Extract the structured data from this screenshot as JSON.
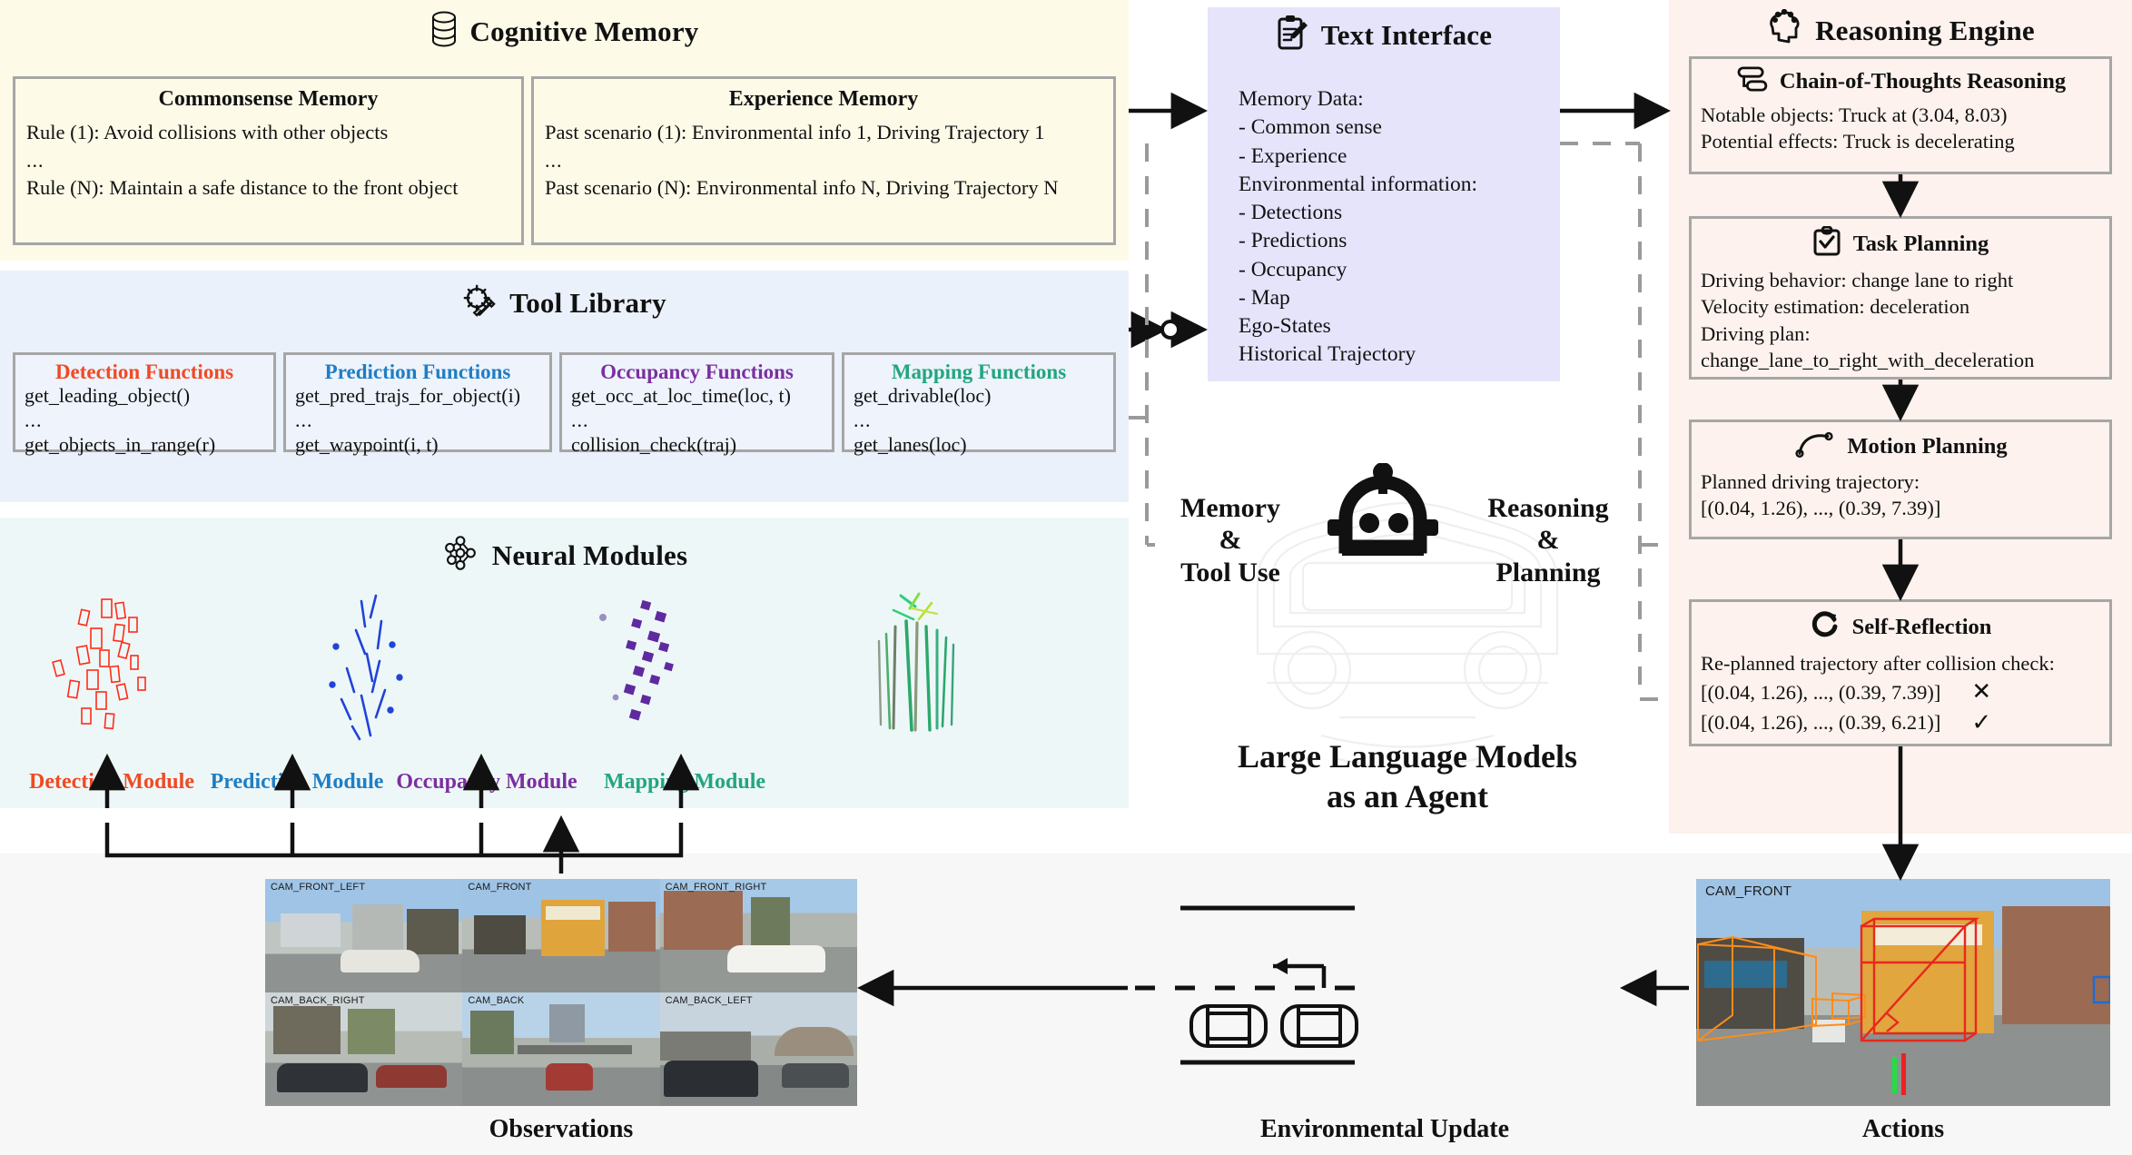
{
  "cognitive_memory": {
    "title": "Cognitive Memory",
    "icon": "database-icon",
    "commonsense": {
      "title": "Commonsense Memory",
      "lines": [
        "Rule (1): Avoid collisions with other objects",
        "...",
        "Rule (N): Maintain a safe distance to the front object"
      ]
    },
    "experience": {
      "title": "Experience Memory",
      "lines": [
        "Past scenario (1): Environmental info 1, Driving Trajectory 1",
        "...",
        "Past scenario (N): Environmental info N, Driving Trajectory N"
      ]
    }
  },
  "tool_library": {
    "title": "Tool Library",
    "icon": "gear-wrench-icon",
    "groups": [
      {
        "title": "Detection Functions",
        "color": "#f04a23",
        "lines": [
          "get_leading_object()",
          "...",
          "get_objects_in_range(r)"
        ]
      },
      {
        "title": "Prediction Functions",
        "color": "#1f7ec4",
        "lines": [
          "get_pred_trajs_for_object(i)",
          "...",
          "get_waypoint(i, t)"
        ]
      },
      {
        "title": "Occupancy Functions",
        "color": "#7b2fa0",
        "lines": [
          "get_occ_at_loc_time(loc, t)",
          "...",
          "collision_check(traj)"
        ]
      },
      {
        "title": "Mapping Functions",
        "color": "#22a67e",
        "lines": [
          "get_drivable(loc)",
          "...",
          "get_lanes(loc)"
        ]
      }
    ]
  },
  "neural_modules": {
    "title": "Neural Modules",
    "icon": "neural-network-icon",
    "modules": [
      {
        "label": "Detection Module",
        "color": "#f04a23"
      },
      {
        "label": "Prediction Module",
        "color": "#1f7ec4"
      },
      {
        "label": "Occupancy Module",
        "color": "#7b2fa0"
      },
      {
        "label": "Mapping Module",
        "color": "#22a67e"
      }
    ]
  },
  "text_interface": {
    "title": "Text Interface",
    "icon": "clipboard-pencil-icon",
    "lines": [
      "Memory Data:",
      "- Common sense",
      "- Experience",
      "Environmental information:",
      "- Detections",
      "- Predictions",
      "- Occupancy",
      "- Map",
      "Ego-States",
      "Historical Trajectory"
    ]
  },
  "reasoning_engine": {
    "title": "Reasoning Engine",
    "icon": "brain-gear-icon",
    "steps": [
      {
        "title": "Chain-of-Thoughts Reasoning",
        "icon": "chain-of-thoughts-icon",
        "lines": [
          "Notable objects: Truck at (3.04, 8.03)",
          "Potential effects: Truck is decelerating"
        ]
      },
      {
        "title": "Task Planning",
        "icon": "clipboard-check-icon",
        "lines": [
          "Driving behavior: change lane to right",
          "Velocity estimation: deceleration",
          "Driving plan:",
          "change_lane_to_right_with_deceleration"
        ]
      },
      {
        "title": "Motion Planning",
        "icon": "trajectory-curve-icon",
        "lines": [
          "Planned driving trajectory:",
          "[(0.04, 1.26), ..., (0.39, 7.39)]"
        ]
      },
      {
        "title": "Self-Reflection",
        "icon": "refresh-circular-arrow-icon",
        "lines": [
          "Re-planned trajectory after collision check:"
        ],
        "results": [
          {
            "text": "[(0.04, 1.26), ..., (0.39, 7.39)]",
            "mark": "✕"
          },
          {
            "text": "[(0.04, 1.26), ..., (0.39, 6.21)]",
            "mark": "✓"
          }
        ]
      }
    ]
  },
  "agent": {
    "left_label": "Memory\n&\nTool Use",
    "right_label": "Reasoning\n&\nPlanning",
    "caption": "Large Language Models\nas an Agent",
    "icon": "robot-head-icon"
  },
  "bottom": {
    "observations_label": "Observations",
    "environmental_update_label": "Environmental Update",
    "actions_label": "Actions",
    "cameras": [
      "CAM_FRONT_LEFT",
      "CAM_FRONT",
      "CAM_FRONT_RIGHT",
      "CAM_BACK_RIGHT",
      "CAM_BACK",
      "CAM_BACK_LEFT"
    ],
    "action_camera": "CAM_FRONT"
  },
  "colors": {
    "memory_bg": "#fdfae8",
    "tool_bg": "#eaf1fb",
    "neural_bg": "#eef7f8",
    "text_interface_bg": "#e5e4fb",
    "reasoning_bg": "#fdf2ed",
    "bottom_bg": "#f7f7f7",
    "card_border": "#a6a6a6",
    "dashed_line": "#9a9a9a"
  }
}
